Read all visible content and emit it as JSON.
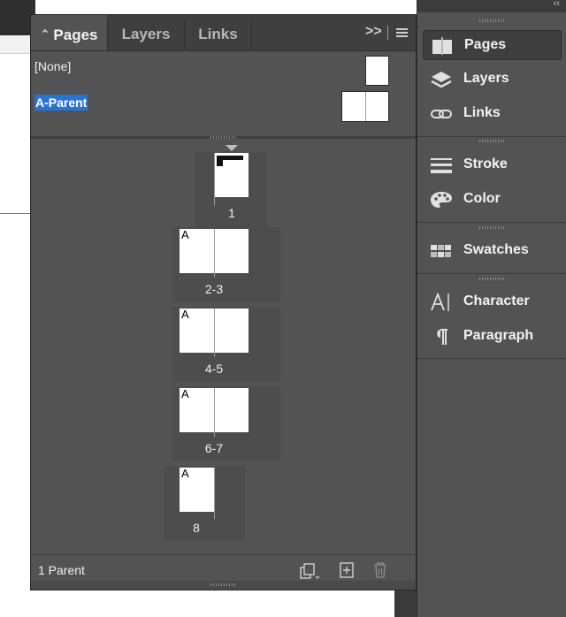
{
  "panel": {
    "tabs": [
      {
        "label": "Pages"
      },
      {
        "label": "Layers"
      },
      {
        "label": "Links"
      }
    ],
    "expand_control": ">>",
    "parents": [
      {
        "label": "[None]"
      },
      {
        "label": "A-Parent"
      }
    ],
    "pages": [
      {
        "label": "1",
        "prefix": ""
      },
      {
        "label": "2-3",
        "prefix": "A"
      },
      {
        "label": "4-5",
        "prefix": "A"
      },
      {
        "label": "6-7",
        "prefix": "A"
      },
      {
        "label": "8",
        "prefix": "A"
      }
    ],
    "footer": {
      "status": "1 Parent"
    }
  },
  "dock": {
    "items": [
      {
        "label": "Pages"
      },
      {
        "label": "Layers"
      },
      {
        "label": "Links"
      },
      {
        "label": "Stroke"
      },
      {
        "label": "Color"
      },
      {
        "label": "Swatches"
      },
      {
        "label": "Character"
      },
      {
        "label": "Paragraph"
      }
    ],
    "collapse_label": "‹‹"
  },
  "colors": {
    "panel_bg": "#535353",
    "selection": "#2a73d6",
    "guide": "#d040c0"
  }
}
